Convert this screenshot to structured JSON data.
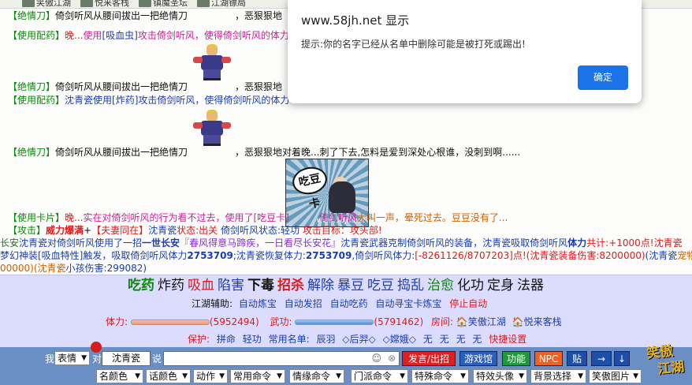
{
  "tabs": [
    "笑傲江湖",
    "悦来客栈",
    "镇魔圣坛",
    "江湖镖局"
  ],
  "chat": {
    "l1": {
      "a": "【绝情刀】",
      "b": "倚剑听风从腰间拔出一把绝情刀",
      "c": "，恶狠狠地"
    },
    "l2": {
      "a": "【使用配药】",
      "b": "晚...",
      "c": "使用",
      "d": "[吸血虫]",
      "e": "攻击倚剑听风",
      "f": "，使得倚剑听风的体力"
    },
    "l3": {
      "a": "【绝情刀】",
      "b": "倚剑听风从腰间拔出一把绝情刀",
      "c": "，恶狠狠地"
    },
    "l4": {
      "a": "【使用配药】",
      "b": "沈青瓷使用",
      "c": "[炸药]",
      "d": "攻击倚剑听风",
      "e": "，使得倚剑听风的体力"
    },
    "l5": {
      "a": "【绝情刀】",
      "b": "倚剑听风从腰间拔出一把绝情刀",
      "c": "，恶狠狠地对着晚...刺了下去,怎料是爱到深处心根谁，没刺到啊......"
    },
    "l6": {
      "a": "【使用卡片】",
      "b": "晚...",
      "c": "实在对倚剑听风的行为看不过去，使用了",
      "d": "[吃豆卡]",
      "e": "倚剑听风",
      "f": "大叫一声，晕死过去。豆豆没有了..."
    },
    "l7": {
      "a": "【攻击】",
      "b": "威力爆满",
      "c": "+",
      "d": "【夫妻同在】",
      "e": "沈青瓷",
      "f": "状态:出关 ",
      "g": "倚剑听风",
      "h": "状态:轻功 ",
      "i": "攻击目标：攻头部!"
    },
    "l8": {
      "a": "长安",
      "b": "沈青瓷",
      "c": "对倚剑听风使用了一招",
      "d": "一世长安",
      "e": "『春风得意马蹄疾，一日看尽长安花』",
      "f": "沈青瓷",
      "g": "武器克制倚剑听风的装备，",
      "h": "沈青瓷",
      "i": "吸取倚剑听风",
      "j": "体力",
      "k": "共计:+1000点!沈青瓷"
    },
    "l9": {
      "a": "梦幻神装[吸血特性]触发，吸取倚剑听风体力",
      "b": "2753709",
      "c": ";沈青瓷恢复体力:",
      "d": "2753709",
      "e": ",倚剑听风体力:",
      "f": "[-8261126/8707203]",
      "g": "点!(沈青瓷",
      "h": "装备伤害:8200000)",
      "i": "(沈青瓷",
      "j": "宠物伤害"
    },
    "l10": {
      "a": "00000)(沈青瓷",
      "b": "小孩伤害:299082)"
    },
    "comic_text": "吃豆卡",
    "comic_wm": "www.58jh.net"
  },
  "panel": {
    "actions": [
      {
        "label": "吃药",
        "color": "#0a8a0a",
        "bold": true
      },
      {
        "label": "炸药",
        "color": "#111111",
        "bold": false
      },
      {
        "label": "吸血",
        "color": "#e01a1a",
        "bold": false
      },
      {
        "label": "陷害",
        "color": "#1a3db5",
        "bold": false
      },
      {
        "label": "下毒",
        "color": "#111111",
        "bold": true
      },
      {
        "label": "招杀",
        "color": "#e01a1a",
        "bold": true
      },
      {
        "label": "解除",
        "color": "#1a3db5",
        "bold": false
      },
      {
        "label": "暴豆",
        "color": "#1a3db5",
        "bold": false
      },
      {
        "label": "吃豆",
        "color": "#1a3db5",
        "bold": false
      },
      {
        "label": "捣乱",
        "color": "#1a3db5",
        "bold": false
      },
      {
        "label": "治愈",
        "color": "#0a8a0a",
        "bold": false
      },
      {
        "label": "化功",
        "color": "#111111",
        "bold": false
      },
      {
        "label": "定身",
        "color": "#111111",
        "bold": false
      },
      {
        "label": "法器",
        "color": "#111111",
        "bold": false
      }
    ],
    "assist_label": "江湖辅助:",
    "assist": [
      "自动炼宝",
      "自动发招",
      "自动吃药",
      "自动寻宝卡炼宝"
    ],
    "assist_stop": "停止自动",
    "hp_label": "体力:",
    "hp_value": "(5952494)",
    "mp_label": "武功:",
    "mp_value": "(5791462)",
    "room_label": "房间:",
    "room1": "笑傲江湖",
    "room2": "悦来客栈",
    "protect_label": "保护:",
    "protect_items": [
      "拼命",
      "轻功"
    ],
    "names_label": "常用名单:",
    "names": [
      "辰羽",
      "◇后羿◇",
      "◇嫦娥◇",
      "无",
      "无",
      "无",
      "无"
    ],
    "shortcut": "快捷设置"
  },
  "inputbar": {
    "me_label": "我",
    "emotion": "表情",
    "to_label": "对",
    "target": "沈青瓷",
    "say_label": "说",
    "send": "发言/出招",
    "game": "游戏馆",
    "func": "功能",
    "npc": "NPC",
    "paste": "贴",
    "arrow_right": "→",
    "arrow_down": "↓",
    "selects": [
      "名颜色",
      "话颜色",
      "动作",
      "常用命令",
      "情缘命令",
      "门派命令",
      "特殊命令",
      "特效头像",
      "背景选择",
      "笑傲图片"
    ],
    "logo1": "笑傲",
    "logo2": "江湖"
  },
  "dialog": {
    "title": "www.58jh.net 显示",
    "message": "提示:你的名字已经从名单中删除可能是被打死或踢出!",
    "ok": "确定"
  }
}
